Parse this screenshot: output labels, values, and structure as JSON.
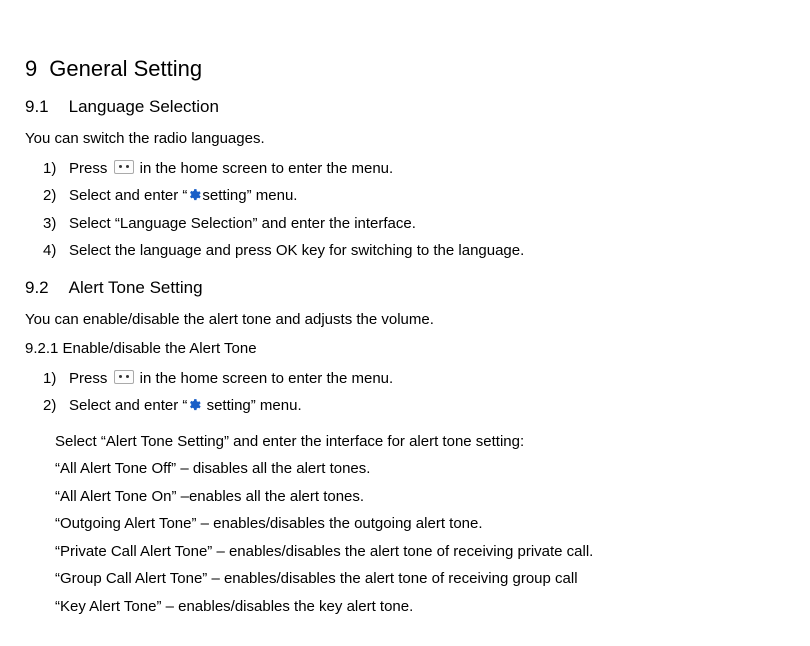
{
  "section9": {
    "number": "9",
    "title": "General Setting",
    "s9_1": {
      "number": "9.1",
      "title": "Language Selection",
      "intro": "You can switch the radio languages.",
      "steps": {
        "s1a": "Press ",
        "s1b": " in the home screen to enter the menu.",
        "s2a": "Select and enter “",
        "s2b": "setting” menu.",
        "s3": "Select “Language Selection” and enter the interface.",
        "s4": "Select the language and press OK key for switching to the language."
      }
    },
    "s9_2": {
      "number": "9.2",
      "title": "Alert Tone Setting",
      "intro": "You can enable/disable the alert tone and adjusts the volume.",
      "s9_2_1": {
        "heading": "9.2.1 Enable/disable the Alert Tone",
        "steps": {
          "s1a": "Press ",
          "s1b": " in the home screen to enter the menu.",
          "s2a": "Select and enter “",
          "s2b": " setting” menu."
        },
        "details": {
          "lead": "Select “Alert Tone Setting” and enter the interface for alert tone setting:",
          "d1": "“All Alert Tone Off” – disables all the alert tones.",
          "d2": "“All Alert Tone On” –enables all the alert tones.",
          "d3": "“Outgoing Alert Tone” – enables/disables the outgoing alert tone.",
          "d4": "“Private Call Alert Tone” – enables/disables the alert tone of receiving private call.",
          "d5": "“Group Call Alert Tone” – enables/disables the alert tone of receiving group call",
          "d6": "“Key Alert Tone” – enables/disables the key alert tone."
        }
      }
    }
  }
}
